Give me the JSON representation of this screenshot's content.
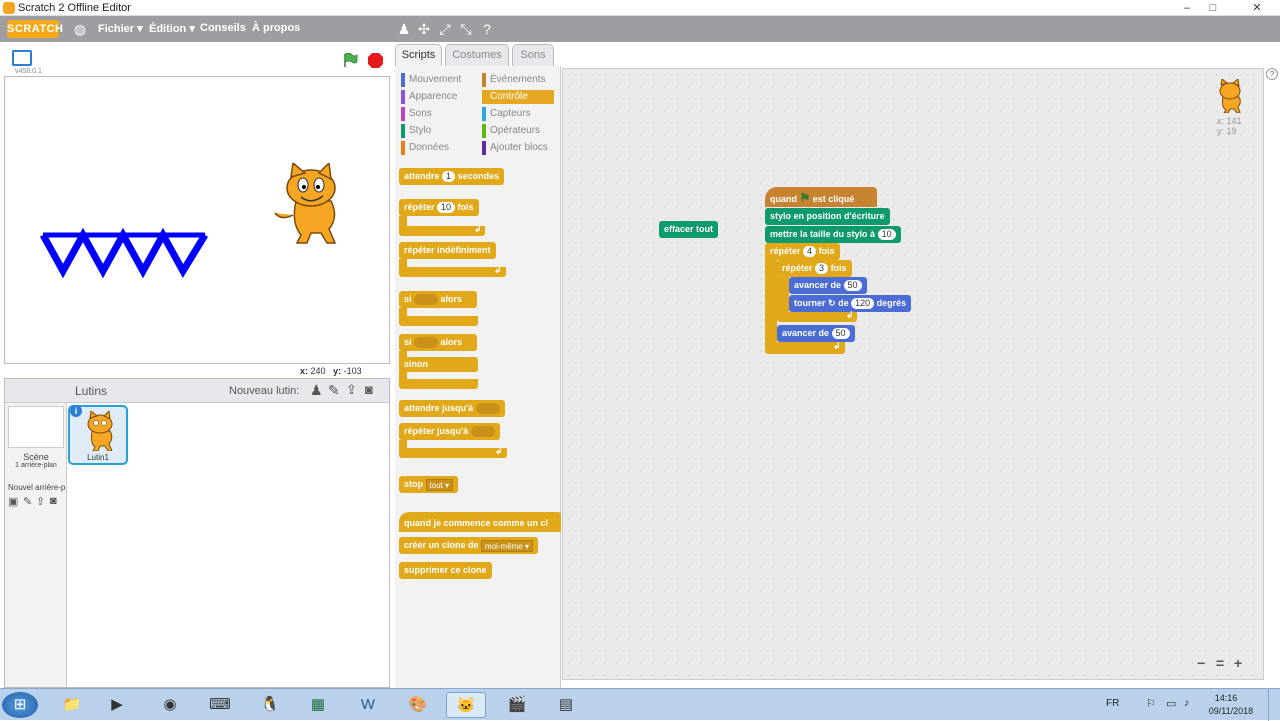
{
  "window": {
    "title": "Scratch 2 Offline Editor",
    "minimize": "–",
    "maximize": "□",
    "close": "✕"
  },
  "menubar": {
    "logo": "SCRATCH",
    "items": [
      "Fichier ▾",
      "Édition ▾",
      "Conseils",
      "À propos"
    ],
    "icons": [
      "globe-icon",
      "duplicate-icon",
      "cut-icon",
      "grow-icon",
      "shrink-icon",
      "help-icon"
    ]
  },
  "stage": {
    "version": "v458.0.1",
    "coords": {
      "x_label": "x:",
      "x": "240",
      "y_label": "y:",
      "y": "-103"
    },
    "drawing_color": "#0000ff"
  },
  "sprites": {
    "header": "Lutins",
    "new_sprite_label": "Nouveau lutin:",
    "stage_label": "Scène",
    "stage_sub": "1 arrière-plan",
    "new_backdrop": "Nouvel arrière-p",
    "sprite_name": "Lutin1",
    "info": "i"
  },
  "tabs": [
    "Scripts",
    "Costumes",
    "Sons"
  ],
  "categories": [
    {
      "label": "Mouvement",
      "color": "#4a6cd4"
    },
    {
      "label": "Événements",
      "color": "#c88330"
    },
    {
      "label": "Apparence",
      "color": "#8a55d7"
    },
    {
      "label": "Contrôle",
      "color": "#e1a91a"
    },
    {
      "label": "Sons",
      "color": "#bb42c3"
    },
    {
      "label": "Capteurs",
      "color": "#2ca5e2"
    },
    {
      "label": "Stylo",
      "color": "#0e9a6c"
    },
    {
      "label": "Opérateurs",
      "color": "#5cb712"
    },
    {
      "label": "Données",
      "color": "#ee7d16"
    },
    {
      "label": "Ajouter blocs",
      "color": "#632d99"
    }
  ],
  "palette": {
    "wait": "attendre",
    "wait_val": "1",
    "wait_unit": "secondes",
    "repeat": "répéter",
    "repeat_val": "10",
    "repeat_unit": "fois",
    "forever": "répéter indéfiniment",
    "if": "si",
    "then": "alors",
    "else": "sinon",
    "wait_until": "attendre jusqu'à",
    "repeat_until": "répéter jusqu'à",
    "stop": "stop",
    "stop_opt": "tout ▾",
    "clone_start": "quand je commence comme un cl",
    "create_clone": "créer un clone de",
    "clone_opt": "moi-même ▾",
    "delete_clone": "supprimer ce clone"
  },
  "script": {
    "hat": "quand",
    "hat_end": "est cliqué",
    "pen_pos": "stylo en position d'écriture",
    "pen_size": "mettre la taille du stylo à",
    "pen_size_val": "10",
    "repeat_outer": "répéter",
    "repeat_outer_val": "4",
    "repeat_outer_unit": "fois",
    "repeat_inner": "répéter",
    "repeat_inner_val": "3",
    "repeat_inner_unit": "fois",
    "move": "avancer de",
    "move_val": "50",
    "turn": "tourner",
    "turn_of": "de",
    "turn_val": "120",
    "turn_unit": "degrés",
    "move2": "avancer de",
    "move2_val": "50",
    "clear": "effacer tout"
  },
  "sprite_info": {
    "x": "x: 141",
    "y": "y: 19"
  },
  "zoom": {
    "out": "−",
    "reset": "=",
    "in": "+"
  },
  "taskbar": {
    "lang": "FR",
    "time": "14:16",
    "date": "09/11/2018"
  }
}
